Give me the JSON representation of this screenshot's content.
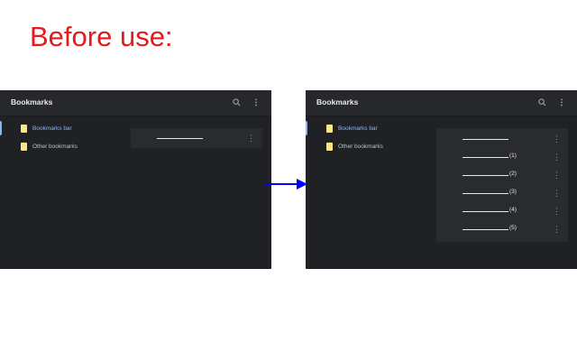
{
  "headline": "Before use:",
  "left_panel": {
    "title": "Bookmarks",
    "search_icon": "search-icon",
    "menu_icon": "more-vert-icon",
    "sidebar": [
      {
        "label": "Bookmarks bar",
        "active": true
      },
      {
        "label": "Other bookmarks",
        "active": false
      }
    ],
    "rows": [
      {
        "number": ""
      }
    ]
  },
  "right_panel": {
    "title": "Bookmarks",
    "search_icon": "search-icon",
    "menu_icon": "more-vert-icon",
    "sidebar": [
      {
        "label": "Bookmarks bar",
        "active": true
      },
      {
        "label": "Other bookmarks",
        "active": false
      }
    ],
    "rows": [
      {
        "number": ""
      },
      {
        "number": "(1)"
      },
      {
        "number": "(2)"
      },
      {
        "number": "(3)"
      },
      {
        "number": "(4)"
      },
      {
        "number": "(5)"
      }
    ]
  },
  "colors": {
    "headline": "#e41a1c",
    "panel_bg": "#202124",
    "accent": "#8ab4f8",
    "arrow": "#0000ff",
    "folder": "#fde68a"
  }
}
